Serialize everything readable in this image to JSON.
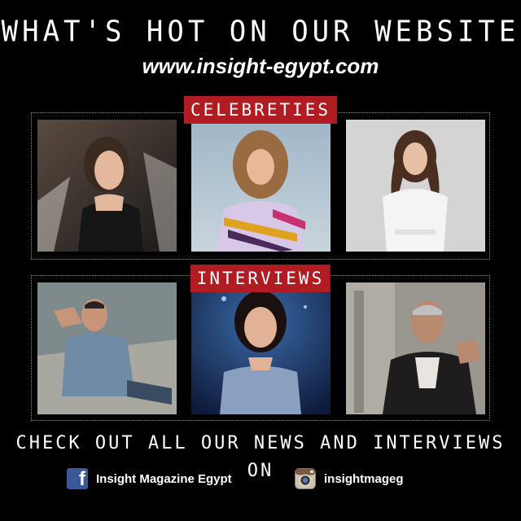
{
  "header": {
    "headline": "WHAT'S HOT ON OUR WEBSITE",
    "url": "www.insight-egypt.com"
  },
  "sections": {
    "celebrities": {
      "label": "CELEBRETIES"
    },
    "interviews": {
      "label": "INTERVIEWS"
    }
  },
  "footer": {
    "cta": "CHECK OUT ALL OUR NEWS AND INTERVIEWS ON",
    "facebook": {
      "text": "Insight Magazine Egypt",
      "icon": "facebook-icon"
    },
    "instagram": {
      "text": "insightmageg",
      "icon": "instagram-icon"
    }
  },
  "colors": {
    "background": "#000000",
    "label_red": "#b01c22",
    "facebook_blue": "#3b5998"
  }
}
